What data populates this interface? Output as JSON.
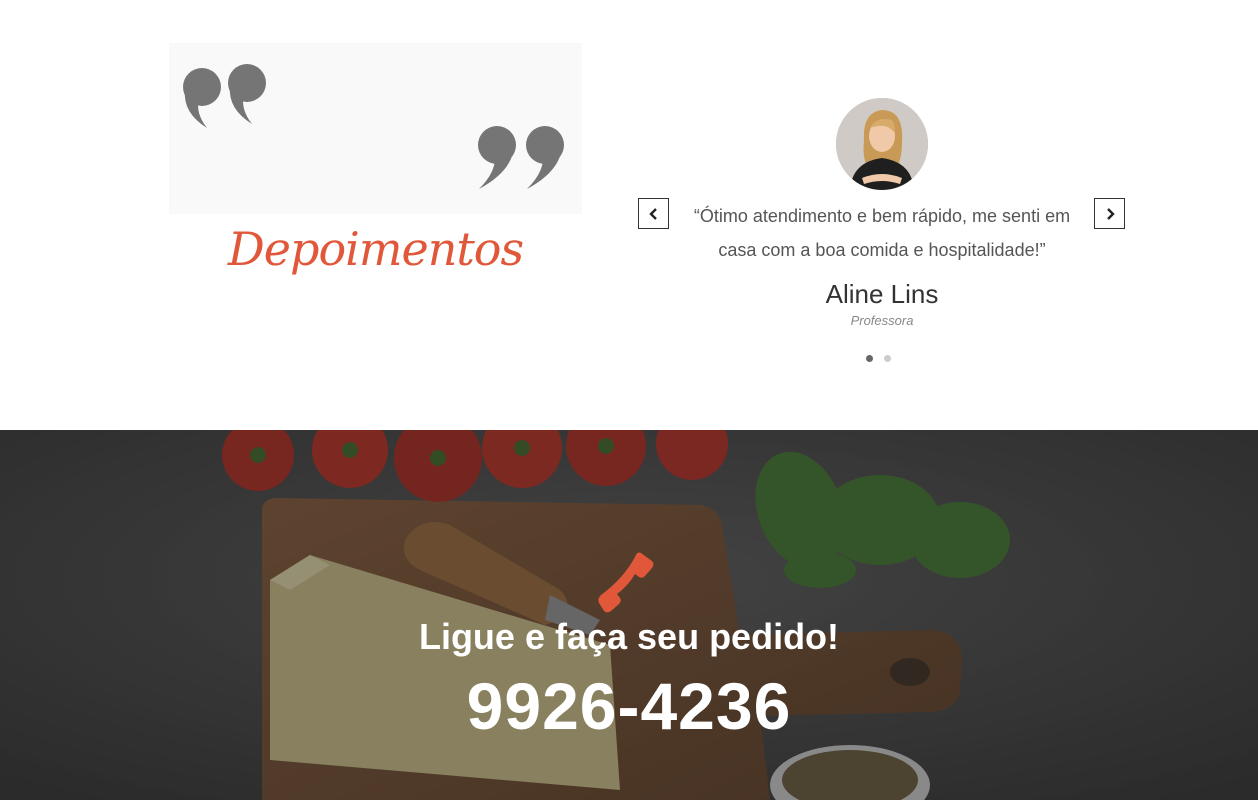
{
  "testimonials": {
    "title": "Depoimentos",
    "quote_icon": "quote-marks-icon",
    "items": [
      {
        "text": "“Ótimo atendimento e bem rápido, me senti em casa com a boa comida e hospitalidade!”",
        "name": "Aline Lins",
        "role": "Professora",
        "avatar": "avatar-woman"
      }
    ],
    "active_index": 0,
    "dot_count": 2,
    "prev_icon": "chevron-left-icon",
    "next_icon": "chevron-right-icon"
  },
  "cta": {
    "icon": "phone-icon",
    "text": "Ligue e faça seu pedido!",
    "phone": "9926-4236",
    "background": "food-cutting-board-image"
  },
  "colors": {
    "accent": "#e0573a",
    "text": "#555555",
    "dark": "#333333"
  }
}
